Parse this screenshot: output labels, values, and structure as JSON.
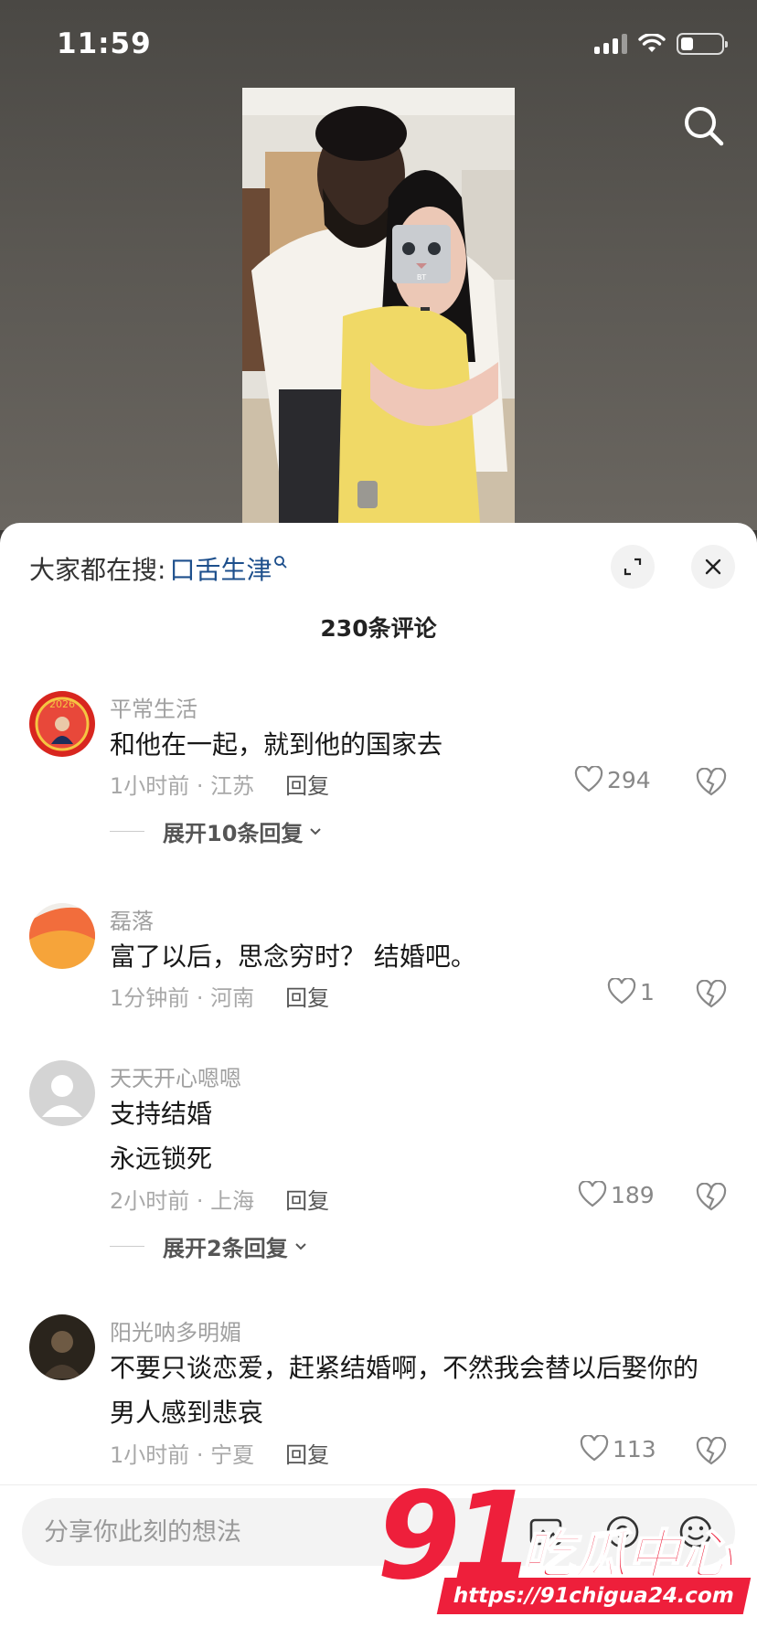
{
  "status": {
    "time": "11:59"
  },
  "sheet": {
    "hot_search_label": "大家都在搜:",
    "hot_search_keyword": "口舌生津",
    "comment_count": "230条评论"
  },
  "video": {
    "face_sticker_text": "BT"
  },
  "comments": [
    {
      "user": "平常生活",
      "text": "和他在一起，就到他的国家去",
      "meta": "1小时前 · 江苏",
      "reply": "回复",
      "likes": "294",
      "expand": "展开10条回复"
    },
    {
      "user": "磊落",
      "text": "富了以后，思念穷时？  结婚吧。",
      "meta": "1分钟前 · 河南",
      "reply": "回复",
      "likes": "1"
    },
    {
      "user": "天天开心嗯嗯",
      "text_line1": "支持结婚",
      "text_line2": "永远锁死",
      "meta": "2小时前 · 上海",
      "reply": "回复",
      "likes": "189",
      "expand": "展开2条回复"
    },
    {
      "user": "阳光呐多明媚",
      "text_line1": "不要只谈恋爱，赶紧结婚啊，不然我会替以后娶你的",
      "text_line2": "男人感到悲哀",
      "meta": "1小时前 · 宁夏",
      "reply": "回复",
      "likes": "113"
    }
  ],
  "input": {
    "placeholder": "分享你此刻的想法"
  },
  "watermark": {
    "number": "91",
    "chinese": "吃瓜中心",
    "url": "https://91chigua24.com"
  },
  "colors": {
    "keyword": "#1d4f8c",
    "watermark": "#ee1f3b"
  }
}
